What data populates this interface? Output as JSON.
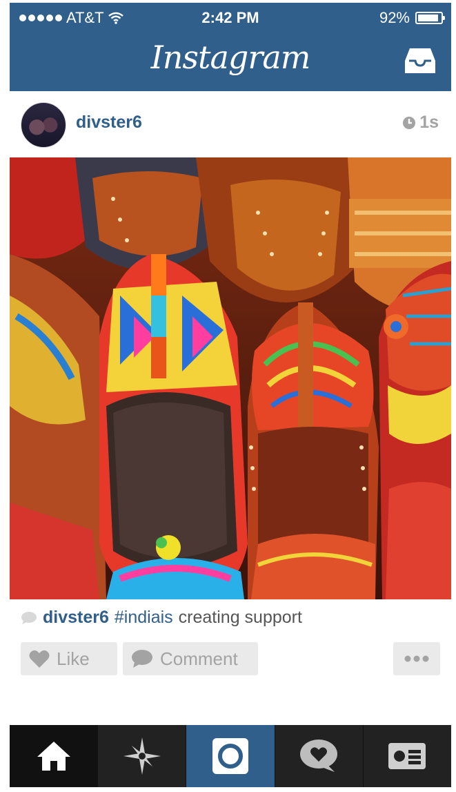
{
  "status_bar": {
    "carrier": "AT&T",
    "time": "2:42 PM",
    "battery": "92%",
    "battery_level": 0.92
  },
  "nav": {
    "title": "Instagram",
    "inbox_icon": "inbox-icon"
  },
  "post": {
    "username": "divster6",
    "time_ago": "1s",
    "photo_icon": "photo",
    "caption": {
      "username": "divster6",
      "hashtag": "#indiais",
      "text": "creating support"
    }
  },
  "actions": {
    "like_label": "Like",
    "comment_label": "Comment"
  },
  "tabbar": {
    "items": [
      "home",
      "explore",
      "camera",
      "activity",
      "profile"
    ]
  },
  "colors": {
    "brand": "#2f5f8a",
    "muted": "#a3a3a3",
    "button_bg": "#eaeaea",
    "tabbar_bg": "#222222"
  }
}
